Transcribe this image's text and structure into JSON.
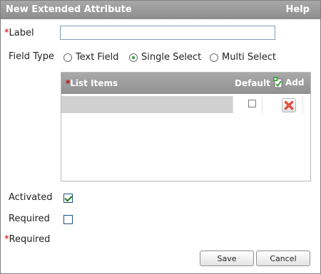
{
  "dialog": {
    "title": "New Extended Attribute",
    "help": "Help"
  },
  "form": {
    "label_star": "*",
    "label_text": "Label",
    "label_value": "",
    "field_type_label": "Field Type",
    "field_types": [
      {
        "label": "Text Field",
        "selected": false
      },
      {
        "label": "Single Select",
        "selected": true
      },
      {
        "label": "Multi Select",
        "selected": false
      }
    ],
    "list": {
      "star": "*",
      "header_items": "List Items",
      "header_default": "Default",
      "add_label": "Add",
      "rows": [
        {
          "value": "",
          "default": false
        }
      ]
    },
    "activated_label": "Activated",
    "activated": true,
    "required_label": "Required",
    "required": false,
    "required_note_star": "*",
    "required_note": "Required"
  },
  "buttons": {
    "save": "Save",
    "cancel": "Cancel"
  },
  "colors": {
    "required_star": "#cc0000",
    "header_bg": "#9b9b9b",
    "check": "#1a7a1a",
    "delete_icon": "#d62a1a"
  }
}
